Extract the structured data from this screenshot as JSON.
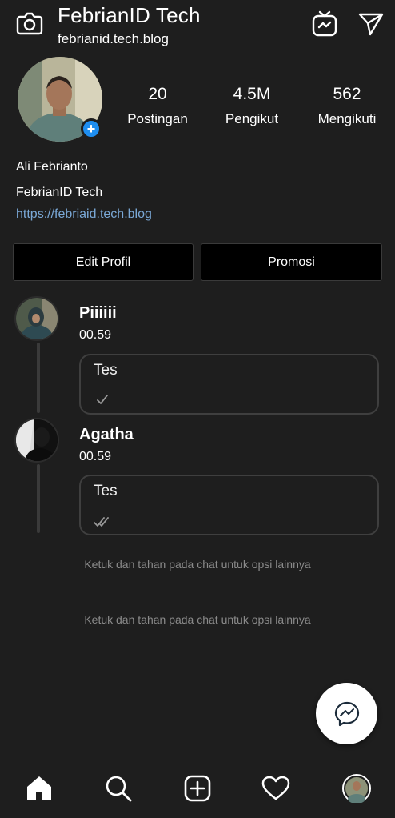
{
  "header": {
    "title": "FebrianID Tech",
    "subtitle": "febrianid.tech.blog"
  },
  "profile": {
    "stats": [
      {
        "value": "20",
        "label": "Postingan"
      },
      {
        "value": "4.5M",
        "label": "Pengikut"
      },
      {
        "value": "562",
        "label": "Mengikuti"
      }
    ],
    "bio_name": "Ali Febrianto",
    "bio_line": "FebrianID Tech",
    "bio_link": "https://febriaid.tech.blog"
  },
  "buttons": {
    "edit": "Edit Profil",
    "promo": "Promosi"
  },
  "chats": [
    {
      "name": "Piiiiii",
      "time": "00.59",
      "message": "Tes",
      "status": "single-check"
    },
    {
      "name": "Agatha",
      "time": "00.59",
      "message": "Tes",
      "status": "double-check"
    }
  ],
  "hints": [
    "Ketuk dan tahan pada chat untuk opsi lainnya",
    "Ketuk dan tahan pada chat untuk opsi lainnya"
  ],
  "icons": {
    "header_left": "camera-icon",
    "header_right": [
      "igtv-icon",
      "send-icon"
    ],
    "fab": "messenger-icon",
    "nav": [
      "home-icon",
      "search-icon",
      "add-post-icon",
      "heart-icon",
      "profile-avatar"
    ]
  },
  "colors": {
    "background": "#1e1e1e",
    "link": "#7aa8d6",
    "add_badge": "#1e8ef0",
    "hint_text": "#8a8a8a"
  }
}
